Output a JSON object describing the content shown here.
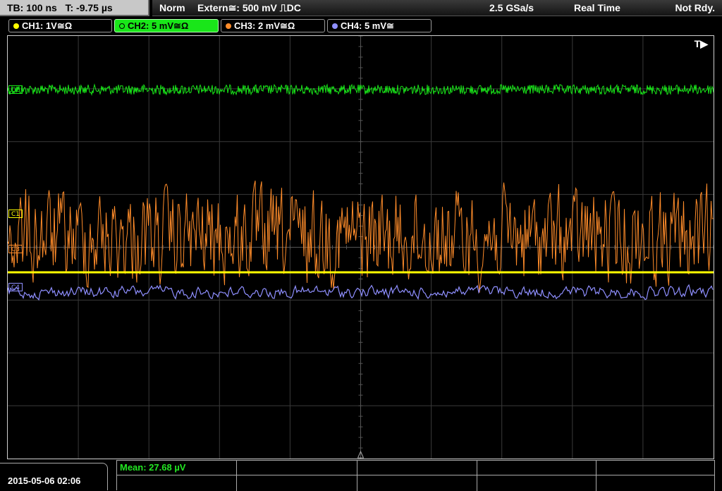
{
  "top_bar": {
    "timebase": "TB: 100 ns",
    "trigger_time": "T: -9.75 µs",
    "mode": "Norm",
    "trigger_source": "Extern≅: 500 mV ⎍DC",
    "sample_rate": "2.5 GSa/s",
    "acquisition": "Real Time",
    "status": "Not Rdy."
  },
  "channels": [
    {
      "label": "CH1: 1V≅Ω",
      "color": "#ffff00",
      "active": false
    },
    {
      "label": "CH2: 5 mV≅Ω",
      "color": "#19e619",
      "active": true
    },
    {
      "label": "CH3: 2 mV≅Ω",
      "color": "#ff8c2a",
      "active": false
    },
    {
      "label": "CH4: 5 mV≅",
      "color": "#8f8fff",
      "active": false
    }
  ],
  "screen": {
    "trigger_marker": "T▶",
    "markers": {
      "c1": "C1",
      "c2": "C2",
      "c3": "C3",
      "c4": "C4"
    }
  },
  "datetime": "2015-05-06 02:06",
  "measurements": {
    "mean": "Mean: 27.68 µV"
  }
}
